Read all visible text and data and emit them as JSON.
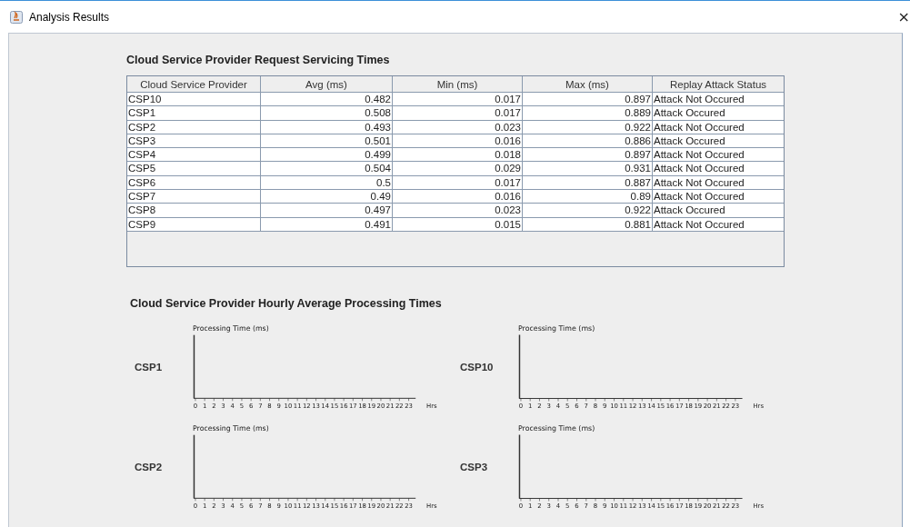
{
  "window": {
    "title": "Analysis Results",
    "close": "×"
  },
  "table_section": {
    "title": "Cloud Service Provider Request Servicing Times"
  },
  "table": {
    "columns": [
      "Cloud Service Provider",
      "Avg (ms)",
      "Min (ms)",
      "Max (ms)",
      "Replay Attack Status"
    ],
    "rows": [
      [
        "CSP10",
        "0.482",
        "0.017",
        "0.897",
        "Attack Not Occured"
      ],
      [
        "CSP1",
        "0.508",
        "0.017",
        "0.889",
        "Attack Occured"
      ],
      [
        "CSP2",
        "0.493",
        "0.023",
        "0.922",
        "Attack Not Occured"
      ],
      [
        "CSP3",
        "0.501",
        "0.016",
        "0.886",
        "Attack Occured"
      ],
      [
        "CSP4",
        "0.499",
        "0.018",
        "0.897",
        "Attack Not Occured"
      ],
      [
        "CSP5",
        "0.504",
        "0.029",
        "0.931",
        "Attack Not Occured"
      ],
      [
        "CSP6",
        "0.5",
        "0.017",
        "0.887",
        "Attack Not Occured"
      ],
      [
        "CSP7",
        "0.49",
        "0.016",
        "0.89",
        "Attack Not Occured"
      ],
      [
        "CSP8",
        "0.497",
        "0.023",
        "0.922",
        "Attack Occured"
      ],
      [
        "CSP9",
        "0.491",
        "0.015",
        "0.881",
        "Attack Not Occured"
      ]
    ]
  },
  "charts_section": {
    "title": "Cloud Service Provider Hourly Average Processing Times"
  },
  "charts": [
    {
      "label": "CSP1",
      "y_axis_label": "Processing Time (ms)",
      "x_axis_label": "Hrs",
      "x_tick_labels": [
        "0",
        "1",
        "2",
        "3",
        "4",
        "5",
        "6",
        "7",
        "8",
        "9",
        "10",
        "11",
        "12",
        "13",
        "14",
        "15",
        "16",
        "17",
        "18",
        "19",
        "20",
        "21",
        "22",
        "23"
      ]
    },
    {
      "label": "CSP10",
      "y_axis_label": "Processing Time (ms)",
      "x_axis_label": "Hrs",
      "x_tick_labels": [
        "0",
        "1",
        "2",
        "3",
        "4",
        "5",
        "6",
        "7",
        "8",
        "9",
        "10",
        "11",
        "12",
        "13",
        "14",
        "15",
        "16",
        "17",
        "18",
        "19",
        "20",
        "21",
        "22",
        "23"
      ]
    },
    {
      "label": "CSP2",
      "y_axis_label": "Processing Time (ms)",
      "x_axis_label": "Hrs",
      "x_tick_labels": [
        "0",
        "1",
        "2",
        "3",
        "4",
        "5",
        "6",
        "7",
        "8",
        "9",
        "10",
        "11",
        "12",
        "13",
        "14",
        "15",
        "16",
        "17",
        "18",
        "19",
        "20",
        "21",
        "22",
        "23"
      ]
    },
    {
      "label": "CSP3",
      "y_axis_label": "Processing Time (ms)",
      "x_axis_label": "Hrs",
      "x_tick_labels": [
        "0",
        "1",
        "2",
        "3",
        "4",
        "5",
        "6",
        "7",
        "8",
        "9",
        "10",
        "11",
        "12",
        "13",
        "14",
        "15",
        "16",
        "17",
        "18",
        "19",
        "20",
        "21",
        "22",
        "23"
      ]
    }
  ]
}
